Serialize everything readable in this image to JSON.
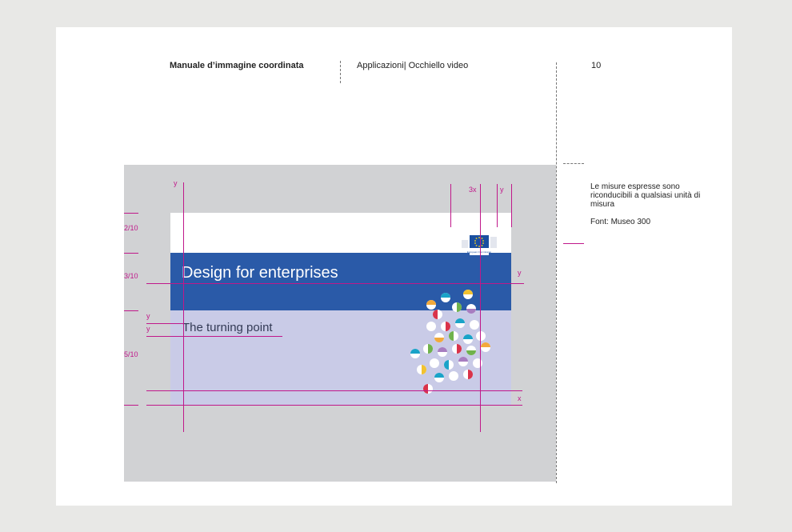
{
  "header": {
    "manual_title": "Manuale d’immagine coordinata",
    "section": "Applicazioni| Occhiello video",
    "page_number": "10"
  },
  "notes": {
    "measures": "Le misure espresse sono riconducibili a qualsiasi unità di misura",
    "font": "Font: Museo 300"
  },
  "slide": {
    "title": "Design for enterprises",
    "subtitle": "The turning point",
    "logo_text": "European Commission"
  },
  "annotations": {
    "ratio_top": "2/10",
    "ratio_mid": "3/10",
    "ratio_bottom": "5/10",
    "y": "y",
    "x": "x",
    "three_x": "3x"
  },
  "colors": {
    "page_bg": "#e8e8e6",
    "stage_grey": "#d1d2d4",
    "eu_blue": "#2a5aa8",
    "lilac": "#c9cbe7",
    "guide_magenta": "#c0188a"
  }
}
